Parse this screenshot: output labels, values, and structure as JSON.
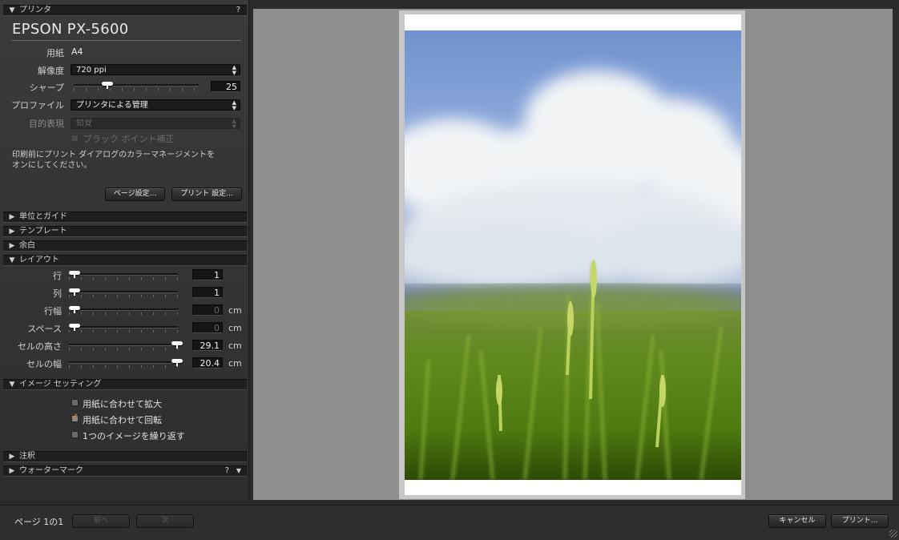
{
  "printer_section": {
    "header": "プリンタ",
    "help": "?",
    "printer_name": "EPSON PX-5600",
    "paper_label": "用紙",
    "paper_value": "A4",
    "resolution_label": "解像度",
    "resolution_value": "720 ppi",
    "sharpen_label": "シャープ",
    "sharpen_value": "25",
    "sharpen_level": 0.25,
    "profile_label": "プロファイル",
    "profile_value": "プリンタによる管理",
    "intent_label": "目的表現",
    "intent_value": "知覚",
    "black_point_label": "ブラック ポイント補正",
    "note_line1": "印刷前にプリント ダイアログのカラーマネージメントを",
    "note_line2": "オンにしてください。",
    "page_setup_button": "ページ設定...",
    "print_settings_button": "プリント 設定..."
  },
  "collapsed_sections": {
    "units": "単位とガイド",
    "template": "テンプレート",
    "margins": "余白"
  },
  "layout_section": {
    "header": "レイアウト",
    "rows_label": "行",
    "rows_value": "1",
    "cols_label": "列",
    "cols_value": "1",
    "row_width_label": "行幅",
    "row_width_value": "0",
    "space_label": "スペース",
    "space_value": "0",
    "cell_height_label": "セルの高さ",
    "cell_height_value": "29.1",
    "cell_width_label": "セルの幅",
    "cell_width_value": "20.4",
    "unit": "cm"
  },
  "image_section": {
    "header": "イメージ セッティング",
    "fit_label": "用紙に合わせて拡大",
    "fit_checked": false,
    "rotate_label": "用紙に合わせて回転",
    "rotate_checked": true,
    "repeat_label": "1つのイメージを繰り返す",
    "repeat_checked": false
  },
  "annotations_section": {
    "header": "注釈"
  },
  "watermark_section": {
    "header": "ウォーターマーク",
    "help": "?"
  },
  "footer": {
    "page_info": "ページ 1の1",
    "prev_button": "前へ",
    "next_button": "次",
    "cancel_button": "キャンセル",
    "print_button": "プリント..."
  },
  "colors": {
    "accent_check": "#e08020",
    "preview_bg": "#8e8e8e"
  }
}
